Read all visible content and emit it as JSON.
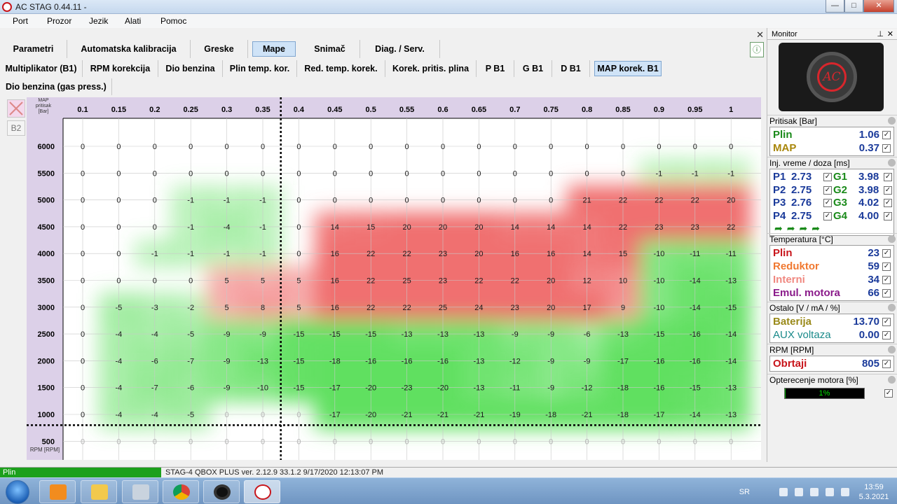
{
  "window": {
    "title": "AC STAG 0.44.11 -"
  },
  "menu": [
    "Port",
    "Prozor",
    "Jezik",
    "Alati",
    "Pomoc"
  ],
  "tabs_main": [
    "Parametri",
    "Automatska kalibracija",
    "Greske",
    "Mape",
    "Snimač",
    "Diag. / Serv."
  ],
  "tabs_main_active": "Mape",
  "tabs_sub": [
    "Multiplikator (B1)",
    "RPM korekcija",
    "Dio benzina",
    "Plin temp. kor.",
    "Red. temp. korek.",
    "Korek. pritis. plina",
    "P B1",
    "G B1",
    "D B1",
    "MAP korek. B1"
  ],
  "tabs_sub_active": "MAP korek. B1",
  "tabs_third": [
    "Dio benzina (gas press.)"
  ],
  "side_button_b2": "B2",
  "map": {
    "axis_header_lines": [
      "MAP",
      "pritisak",
      "[Bar]"
    ],
    "rpm_axis_label": "RPM [RPM]",
    "pressures": [
      "0.1",
      "0.15",
      "0.2",
      "0.25",
      "0.3",
      "0.35",
      "0.4",
      "0.45",
      "0.5",
      "0.55",
      "0.6",
      "0.65",
      "0.7",
      "0.75",
      "0.8",
      "0.85",
      "0.9",
      "0.95",
      "1"
    ],
    "rpms": [
      "6000",
      "5500",
      "5000",
      "4500",
      "4000",
      "3500",
      "3000",
      "2500",
      "2000",
      "1500",
      "1000",
      "500"
    ],
    "values": [
      [
        0,
        0,
        0,
        0,
        0,
        0,
        0,
        0,
        0,
        0,
        0,
        0,
        0,
        0,
        0,
        0,
        0,
        0,
        0
      ],
      [
        0,
        0,
        0,
        0,
        0,
        0,
        0,
        0,
        0,
        0,
        0,
        0,
        0,
        0,
        0,
        0,
        -1,
        -1,
        -1
      ],
      [
        0,
        0,
        0,
        -1,
        -1,
        -1,
        0,
        0,
        0,
        0,
        0,
        0,
        0,
        0,
        21,
        22,
        22,
        22,
        20
      ],
      [
        0,
        0,
        0,
        -1,
        -4,
        -1,
        0,
        14,
        15,
        20,
        20,
        20,
        14,
        14,
        14,
        22,
        23,
        23,
        22
      ],
      [
        0,
        0,
        -1,
        -1,
        -1,
        -1,
        0,
        16,
        22,
        22,
        23,
        20,
        16,
        16,
        14,
        15,
        -10,
        -11,
        -11
      ],
      [
        0,
        0,
        0,
        0,
        5,
        5,
        5,
        16,
        22,
        25,
        23,
        22,
        22,
        20,
        12,
        10,
        -10,
        -14,
        -13
      ],
      [
        0,
        -5,
        -3,
        -2,
        5,
        8,
        5,
        16,
        22,
        22,
        25,
        24,
        23,
        20,
        17,
        9,
        -10,
        -14,
        -15
      ],
      [
        0,
        -4,
        -4,
        -5,
        -9,
        -9,
        -15,
        -15,
        -15,
        -13,
        -13,
        -13,
        -9,
        -9,
        -6,
        -13,
        -15,
        -16,
        -14
      ],
      [
        0,
        -4,
        -6,
        -7,
        -9,
        -13,
        -15,
        -18,
        -16,
        -16,
        -16,
        -13,
        -12,
        -9,
        -9,
        -17,
        -16,
        -16,
        -14
      ],
      [
        0,
        -4,
        -7,
        -6,
        -9,
        -10,
        -15,
        -17,
        -20,
        -23,
        -20,
        -13,
        -11,
        -9,
        -12,
        -18,
        -16,
        -15,
        -13
      ],
      [
        0,
        -4,
        -4,
        -5,
        0,
        0,
        0,
        -17,
        -20,
        -21,
        -21,
        -21,
        -19,
        -18,
        -21,
        -18,
        -17,
        -14,
        -13
      ],
      [
        0,
        0,
        0,
        0,
        0,
        0,
        0,
        0,
        0,
        0,
        0,
        0,
        0,
        0,
        0,
        0,
        0,
        0,
        0
      ]
    ],
    "dimmed": [
      [],
      [],
      [],
      [],
      [],
      [],
      [],
      [],
      [],
      [],
      [
        4,
        5,
        6
      ],
      [
        0,
        1,
        2,
        3,
        4,
        5,
        6,
        7,
        8,
        9,
        10,
        11,
        12,
        13,
        14,
        15,
        16,
        17,
        18
      ]
    ],
    "colors": {
      "positive": "#f07070",
      "negative": "#60e060",
      "crosshair": "#000000"
    },
    "crosshair": {
      "pressure": "0.375",
      "rpm": "800"
    }
  },
  "monitor": {
    "title": "Monitor",
    "pin_icon": "pin-icon",
    "logo_text": "AC",
    "pressure": {
      "header": "Pritisak [Bar]",
      "rows": [
        {
          "label": "Plin",
          "value": "1.06",
          "color": "#1a8a1a"
        },
        {
          "label": "MAP",
          "value": "0.37",
          "color": "#a8860a"
        }
      ]
    },
    "injection": {
      "header": "Inj. vreme / doza [ms]",
      "rows": [
        {
          "p": "P1",
          "pv": "2.73",
          "g": "G1",
          "gv": "3.98"
        },
        {
          "p": "P2",
          "pv": "2.75",
          "g": "G2",
          "gv": "3.98"
        },
        {
          "p": "P3",
          "pv": "2.76",
          "g": "G3",
          "gv": "4.02"
        },
        {
          "p": "P4",
          "pv": "2.75",
          "g": "G4",
          "gv": "4.00"
        }
      ]
    },
    "temperature": {
      "header": "Temperatura [°C]",
      "rows": [
        {
          "label": "Plin",
          "value": "23",
          "color": "#c8151b"
        },
        {
          "label": "Reduktor",
          "value": "59",
          "color": "#f07830"
        },
        {
          "label": "Interni",
          "value": "34",
          "color": "#f08880"
        },
        {
          "label": "Emul. motora",
          "value": "66",
          "color": "#8a1a8a"
        }
      ]
    },
    "other": {
      "header": "Ostalo [V / mA / %]",
      "rows": [
        {
          "label": "Baterija",
          "value": "13.70",
          "color": "#9a8a1a"
        },
        {
          "label": "AUX voltaza",
          "value": "0.00",
          "color": "#1a8a8a"
        }
      ]
    },
    "rpm": {
      "header": "RPM [RPM]",
      "rows": [
        {
          "label": "Obrtaji",
          "value": "805",
          "color": "#c8151b"
        }
      ]
    },
    "load": {
      "header": "Opterecenje motora [%]",
      "value_text": "1%",
      "fraction": 0.01
    }
  },
  "status": {
    "left": "Plin",
    "info": "STAG-4 QBOX PLUS  ver. 2.12.9  33.1.2  9/17/2020 12:13:07 PM"
  },
  "taskbar": {
    "lang": "SR",
    "time": "13:59",
    "date": "5.3.2021",
    "icons": [
      "start-icon",
      "media-player-icon",
      "file-explorer-icon",
      "calculator-icon",
      "chrome-icon",
      "record-icon",
      "ac-stag-icon"
    ]
  }
}
